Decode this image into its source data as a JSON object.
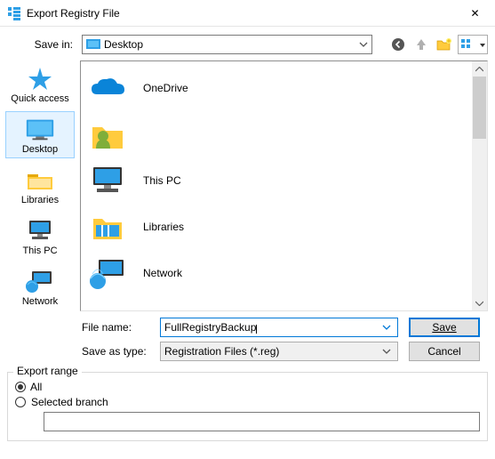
{
  "window": {
    "title": "Export Registry File",
    "close": "✕"
  },
  "top": {
    "savein_label": "Save in:",
    "savein_value": "Desktop",
    "icons": {
      "back": "back-icon",
      "up": "up-one-level-icon",
      "newfolder": "new-folder-icon",
      "views": "views-menu-icon"
    }
  },
  "places": [
    {
      "label": "Quick access",
      "key": "quick-access"
    },
    {
      "label": "Desktop",
      "key": "desktop",
      "selected": true
    },
    {
      "label": "Libraries",
      "key": "libraries"
    },
    {
      "label": "This PC",
      "key": "this-pc"
    },
    {
      "label": "Network",
      "key": "network"
    }
  ],
  "items": [
    {
      "label": "OneDrive",
      "key": "onedrive"
    },
    {
      "label": "",
      "key": "user-folder"
    },
    {
      "label": "This PC",
      "key": "this-pc"
    },
    {
      "label": "Libraries",
      "key": "libraries"
    },
    {
      "label": "Network",
      "key": "network"
    }
  ],
  "fields": {
    "filename_label": "File name:",
    "filename_value": "FullRegistryBackup",
    "savetype_label": "Save as type:",
    "savetype_value": "Registration Files (*.reg)",
    "save_btn": "Save",
    "cancel_btn": "Cancel"
  },
  "export_range": {
    "legend": "Export range",
    "all": "All",
    "selected_branch": "Selected branch",
    "branch_value": "",
    "selected": "All"
  }
}
